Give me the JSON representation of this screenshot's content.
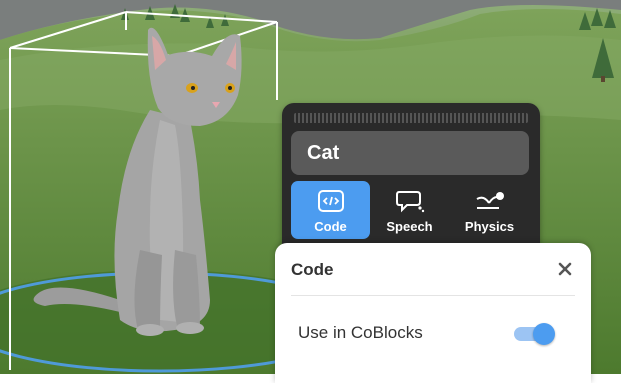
{
  "object": {
    "name": "Cat"
  },
  "tabs": [
    {
      "label": "Code",
      "icon": "code-icon",
      "active": true
    },
    {
      "label": "Speech",
      "icon": "speech-bubble-icon",
      "active": false
    },
    {
      "label": "Physics",
      "icon": "physics-icon",
      "active": false
    }
  ],
  "code_popup": {
    "title": "Code",
    "close_icon": "close-icon",
    "setting": {
      "label": "Use in CoBlocks",
      "enabled": true
    }
  },
  "colors": {
    "accent": "#4c9cf0",
    "panel_bg": "#2a2a2a",
    "name_field_bg": "#5a5a5a",
    "toggle_track": "#9cc4f3"
  }
}
